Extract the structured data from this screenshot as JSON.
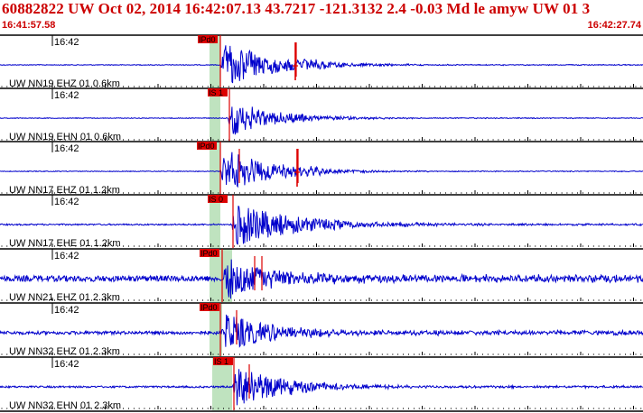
{
  "header": {
    "title": "60882822 UW Oct 02, 2014 16:42:07.13   43.7217 -121.3132  2.4 -0.03 Md le amyw UW 01   3",
    "start_time": "16:41:57.58",
    "end_time": "16:42:27.74"
  },
  "colors": {
    "header_red": "#cc0000",
    "trace_blue": "#0000cc",
    "pick_red": "#dd0000",
    "pick_window_green": "#bfe3bf"
  },
  "panels": [
    {
      "tick_label": "16:42",
      "channel_label": "UW NN19 EHZ 01 0.6km",
      "pick_label": "IPd0"
    },
    {
      "tick_label": "16:42",
      "channel_label": "UW NN19 EHN 01 0.6km",
      "pick_label": "IS 1"
    },
    {
      "tick_label": "16:42",
      "channel_label": "UW NN17 EHZ 01 1.2km",
      "pick_label": "IPd0"
    },
    {
      "tick_label": "16:42",
      "channel_label": "UW NN17 EHE 01 1.2km",
      "pick_label": "IS 0"
    },
    {
      "tick_label": "16:42",
      "channel_label": "UW NN21 EHZ 01 2.3km",
      "pick_label": "IPd0"
    },
    {
      "tick_label": "16:42",
      "channel_label": "UW NN32 EHZ 01 2.3km",
      "pick_label": "IPd0"
    },
    {
      "tick_label": "16:42",
      "channel_label": "UW NN32 EHN 01 2.3km",
      "pick_label": "IS 1"
    }
  ]
}
